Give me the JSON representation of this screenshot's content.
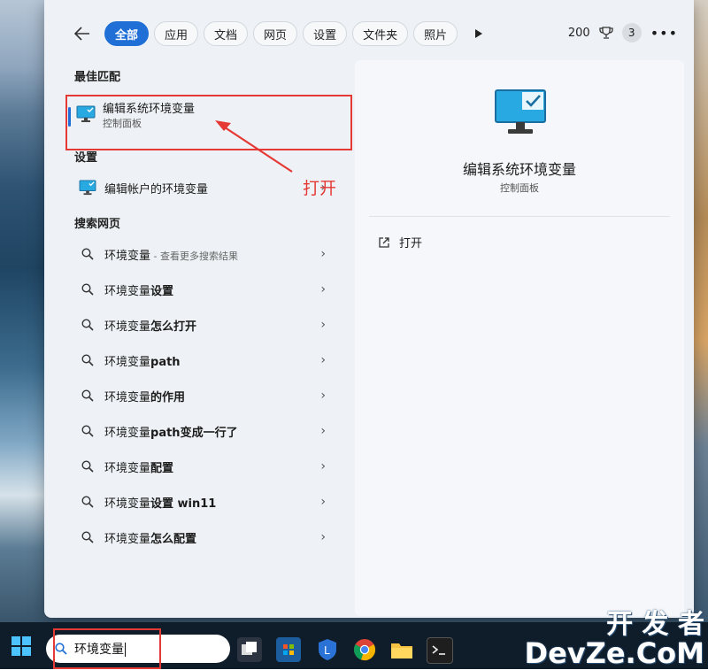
{
  "filters": [
    "全部",
    "应用",
    "文档",
    "网页",
    "设置",
    "文件夹",
    "照片"
  ],
  "rewards_points": "200",
  "notification_count": "3",
  "sections": {
    "best_match": "最佳匹配",
    "settings": "设置",
    "search_web": "搜索网页"
  },
  "best_match": {
    "title": "编辑系统环境变量",
    "subtitle": "控制面板"
  },
  "settings_item": "编辑帐户的环境变量",
  "web_results": [
    {
      "prefix": "环境变量",
      "bold": "",
      "hint": " - 查看更多搜索结果"
    },
    {
      "prefix": "环境变量",
      "bold": "设置",
      "hint": ""
    },
    {
      "prefix": "环境变量",
      "bold": "怎么打开",
      "hint": ""
    },
    {
      "prefix": "环境变量",
      "bold": "path",
      "hint": ""
    },
    {
      "prefix": "环境变量",
      "bold": "的作用",
      "hint": ""
    },
    {
      "prefix": "环境变量",
      "bold": "path变成一行了",
      "hint": ""
    },
    {
      "prefix": "环境变量",
      "bold": "配置",
      "hint": ""
    },
    {
      "prefix": "环境变量",
      "bold": "设置 win11",
      "hint": ""
    },
    {
      "prefix": "环境变量",
      "bold": "怎么配置",
      "hint": ""
    }
  ],
  "detail": {
    "title": "编辑系统环境变量",
    "subtitle": "控制面板",
    "action": "打开"
  },
  "annotation": "打开",
  "search_query": "环境变量",
  "watermark": {
    "line1": "开 发 者",
    "line2": "DevZe.CoM"
  },
  "colors": {
    "accent": "#1f6fd6",
    "annotation": "#e53935"
  }
}
